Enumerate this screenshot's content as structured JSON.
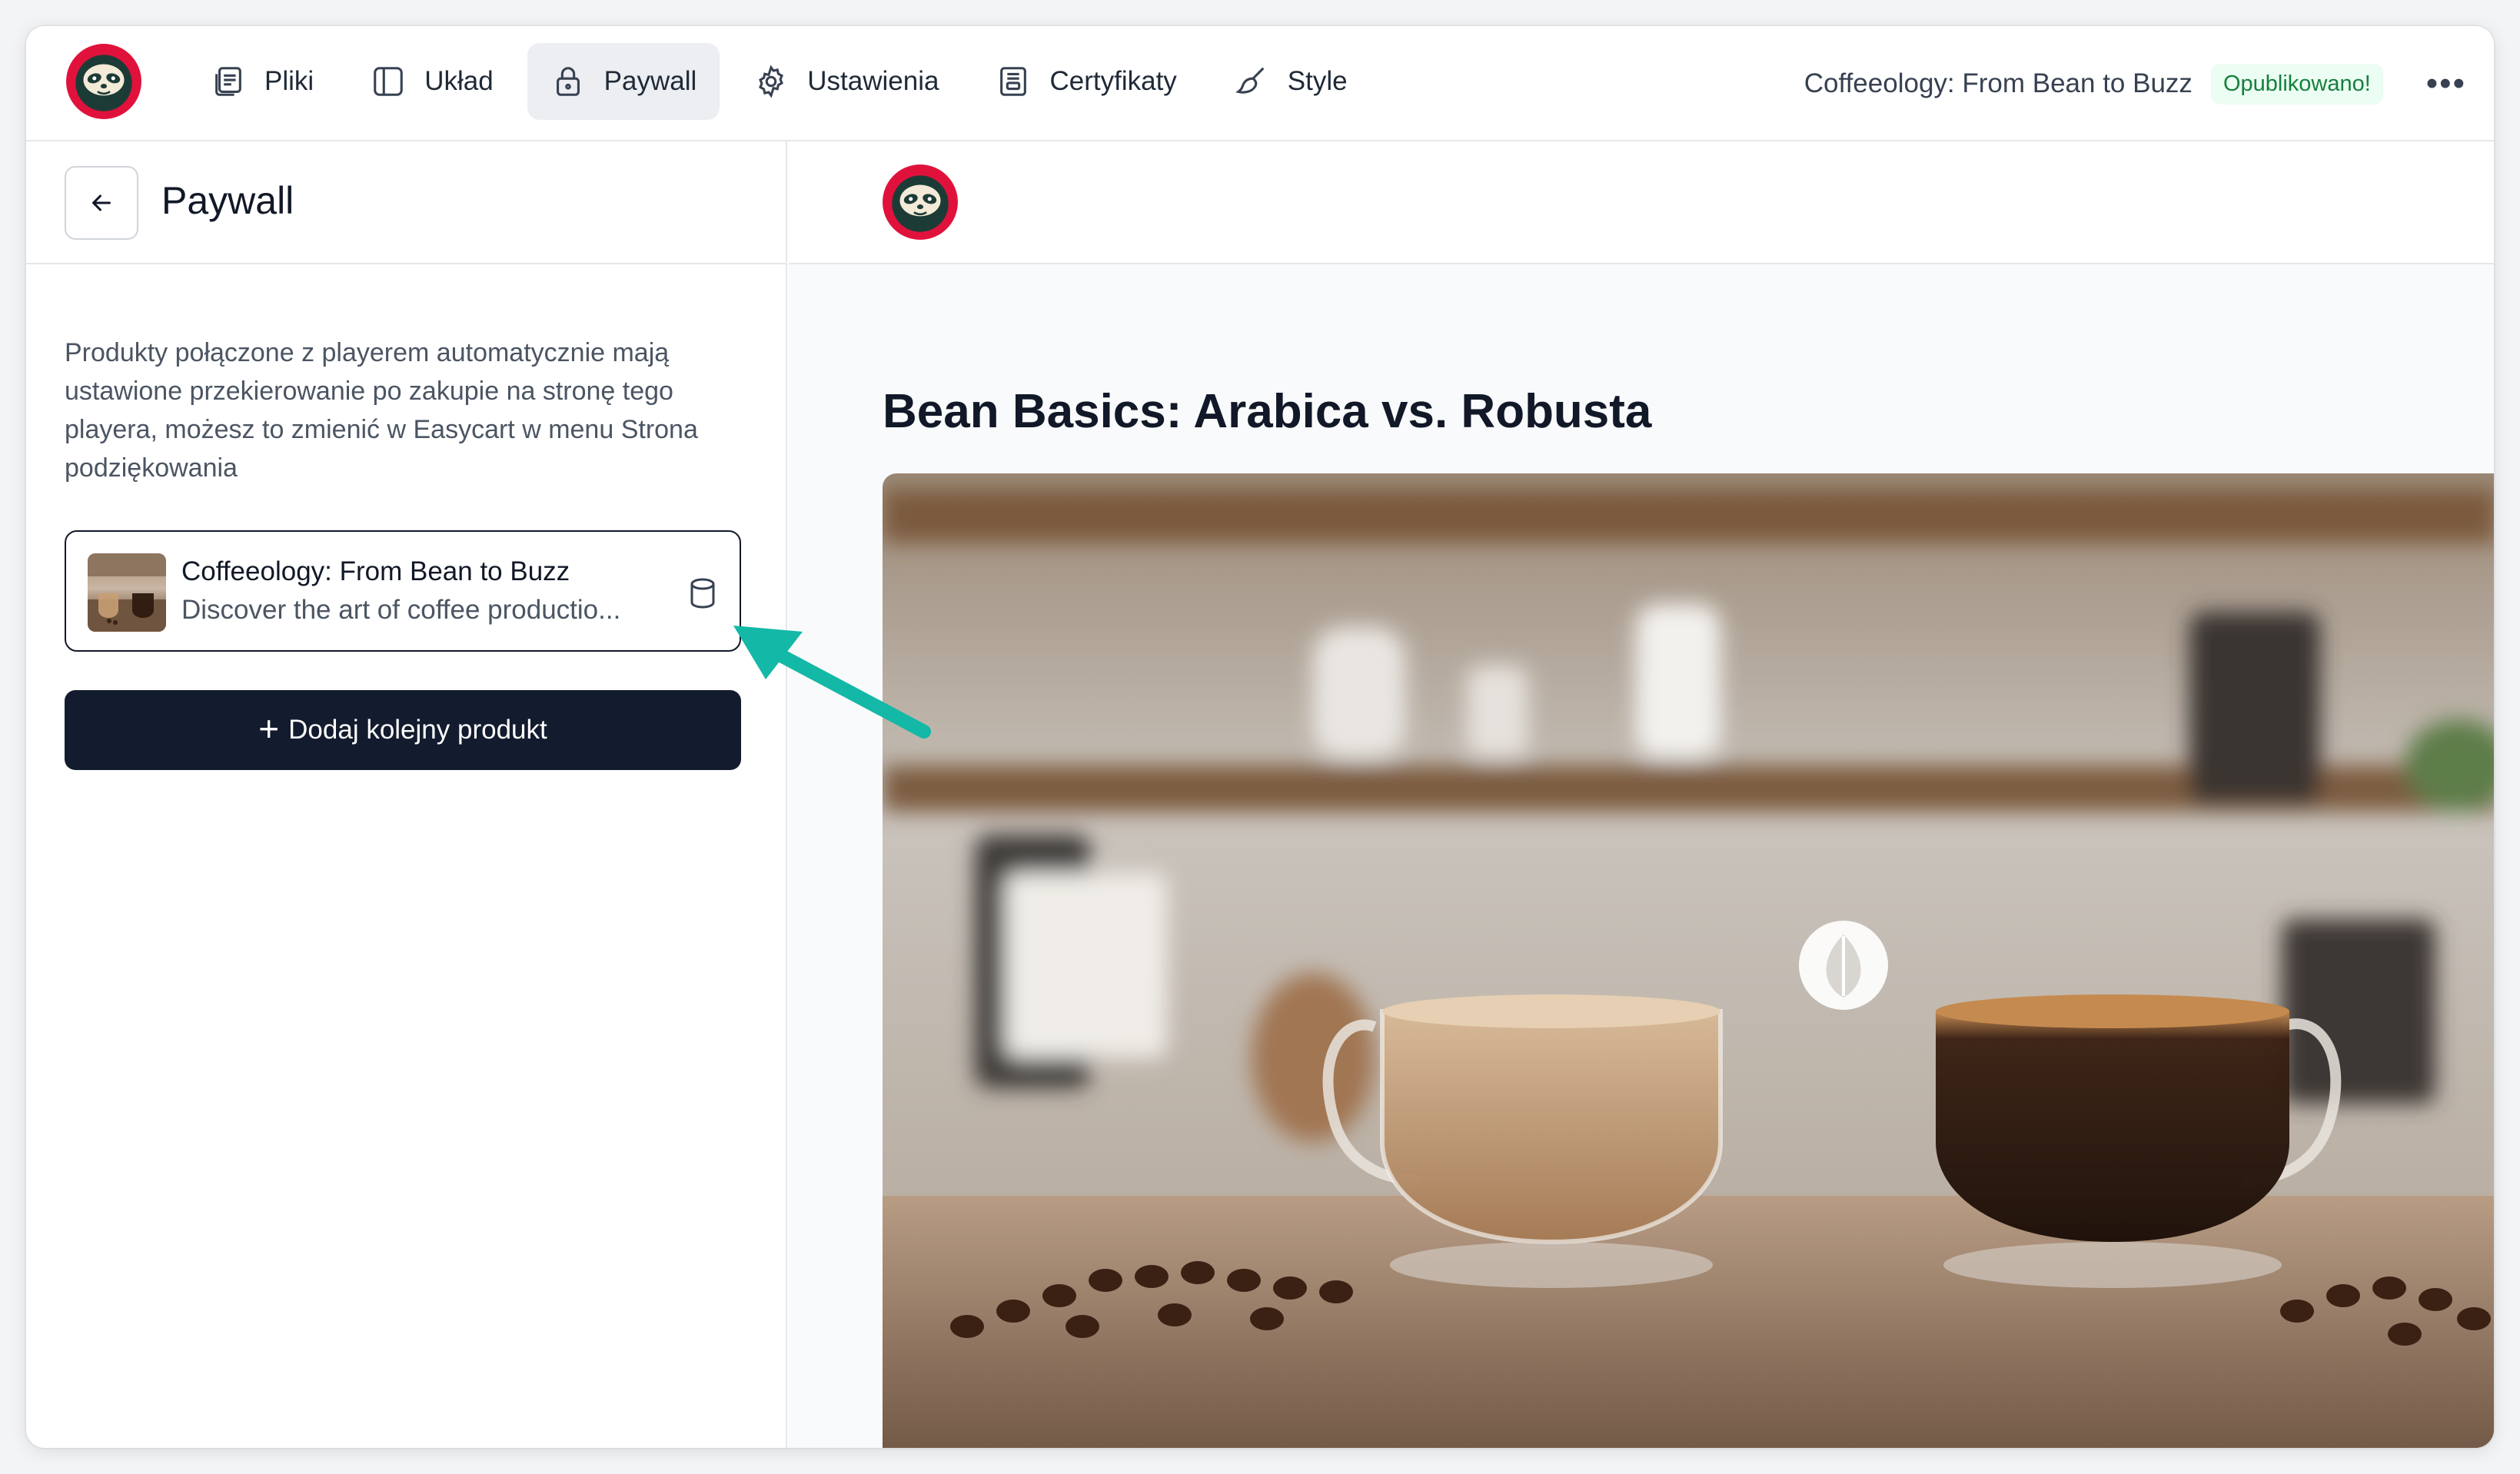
{
  "topbar": {
    "nav": [
      {
        "label": "Pliki",
        "icon": "files-icon",
        "active": false
      },
      {
        "label": "Układ",
        "icon": "layout-icon",
        "active": false
      },
      {
        "label": "Paywall",
        "icon": "lock-icon",
        "active": true
      },
      {
        "label": "Ustawienia",
        "icon": "gear-icon",
        "active": false
      },
      {
        "label": "Certyfikaty",
        "icon": "certificate-icon",
        "active": false
      },
      {
        "label": "Style",
        "icon": "brush-icon",
        "active": false
      }
    ],
    "course_title": "Coffeeology: From Bean to Buzz",
    "status_badge": "Opublikowano!",
    "more_label": "•••"
  },
  "sidebar": {
    "title": "Paywall",
    "description": "Produkty połączone z playerem automatycznie mają ustawione przekierowanie po zakupie na stronę tego playera, możesz to zmienić w Easycart w menu Strona podziękowania",
    "product": {
      "name": "Coffeeology: From Bean to Buzz",
      "description": "Discover the art of coffee productio..."
    },
    "add_button": {
      "icon": "+",
      "label": "Dodaj kolejny produkt"
    }
  },
  "preview": {
    "lesson_title": "Bean Basics: Arabica vs. Robusta"
  },
  "colors": {
    "brand_red": "#e0123c",
    "accent_teal": "#14b8a6",
    "button_dark": "#131c2e",
    "badge_green": "#15803d"
  }
}
